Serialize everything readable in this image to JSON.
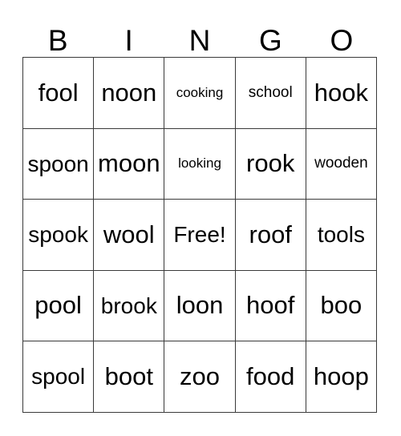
{
  "card": {
    "title": "BINGO",
    "header_letters": [
      "B",
      "I",
      "N",
      "G",
      "O"
    ],
    "free_space_label": "Free!",
    "border_color": "#3a3a3a",
    "text_color": "#000000",
    "background_color": "#ffffff",
    "rows": [
      [
        "fool",
        "noon",
        "cooking",
        "school",
        "hook"
      ],
      [
        "spoon",
        "moon",
        "looking",
        "rook",
        "wooden"
      ],
      [
        "spook",
        "wool",
        "Free!",
        "roof",
        "tools"
      ],
      [
        "pool",
        "brook",
        "loon",
        "hoof",
        "boo"
      ],
      [
        "spool",
        "boot",
        "zoo",
        "food",
        "hoop"
      ]
    ]
  }
}
